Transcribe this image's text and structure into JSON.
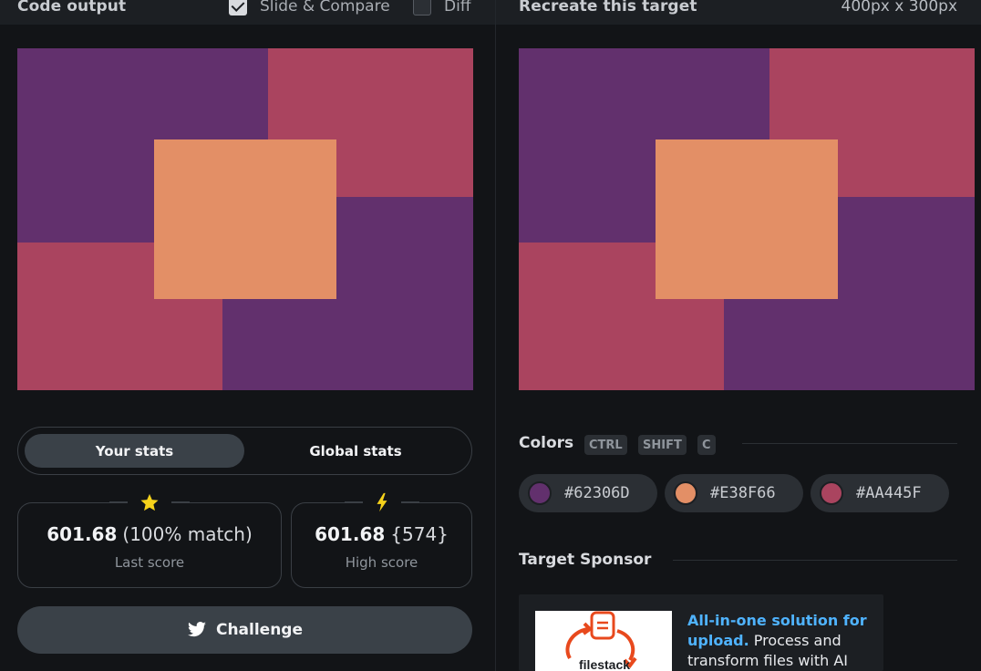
{
  "left": {
    "title": "Code output",
    "slide_compare": {
      "label": "Slide & Compare",
      "checked": true
    },
    "diff": {
      "label": "Diff",
      "checked": false
    }
  },
  "right": {
    "title": "Recreate this target",
    "size": "400px x 300px"
  },
  "art_colors": {
    "purple": "#62306D",
    "orange": "#E38F66",
    "red": "#AA445F"
  },
  "stats": {
    "tabs": [
      {
        "label": "Your stats",
        "active": true
      },
      {
        "label": "Global stats",
        "active": false
      }
    ],
    "last": {
      "icon": "star-icon",
      "value": "601.68",
      "extra": "(100% match)",
      "label": "Last score"
    },
    "high": {
      "icon": "lightning-icon",
      "value": "601.68",
      "extra": "{574}",
      "label": "High score"
    }
  },
  "challenge": {
    "icon": "twitter-icon",
    "label": "Challenge"
  },
  "colors_section": {
    "title": "Colors",
    "shortcut": [
      "CTRL",
      "SHIFT",
      "C"
    ],
    "swatches": [
      {
        "hex": "#62306D",
        "color": "#62306D"
      },
      {
        "hex": "#E38F66",
        "color": "#E38F66"
      },
      {
        "hex": "#AA445F",
        "color": "#AA445F"
      }
    ]
  },
  "sponsor": {
    "title": "Target Sponsor",
    "logo_text": "filestack",
    "headline": "All-in-one solution for upload.",
    "body": " Process and transform files with AI"
  }
}
